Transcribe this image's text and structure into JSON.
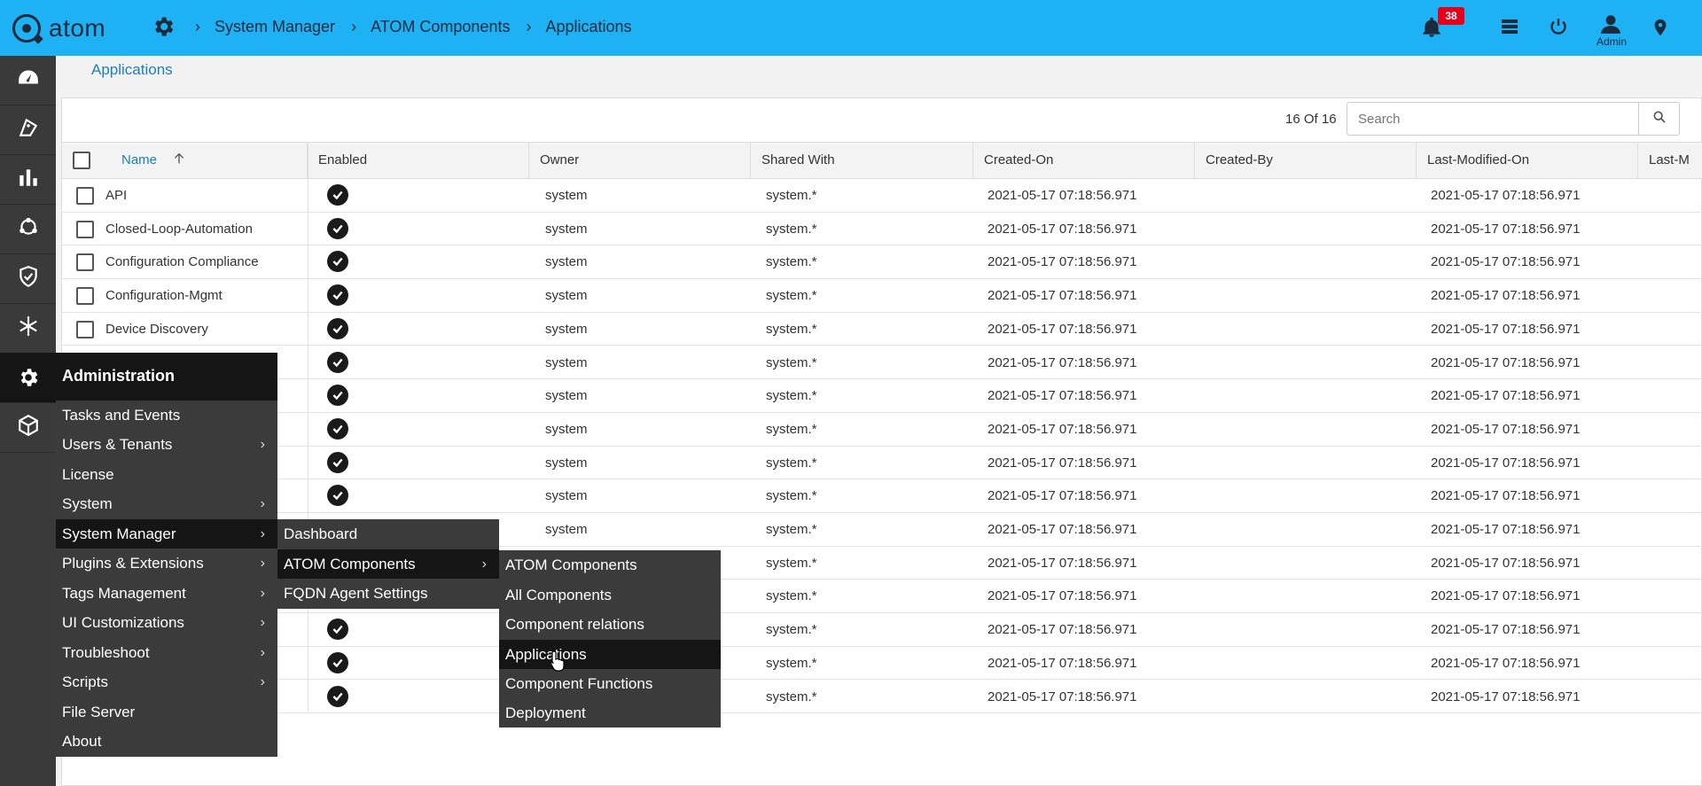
{
  "app": {
    "name": "atom"
  },
  "breadcrumb": [
    "System Manager",
    "ATOM Components",
    "Applications"
  ],
  "notifications": {
    "count": "38"
  },
  "user": {
    "label": "Admin"
  },
  "page": {
    "title": "Applications",
    "count": "16 Of 16"
  },
  "search": {
    "placeholder": "Search",
    "value": ""
  },
  "table": {
    "columns": [
      "Name",
      "Enabled",
      "Owner",
      "Shared With",
      "Created-On",
      "Created-By",
      "Last-Modified-On",
      "Last-M"
    ],
    "sort": {
      "column": "Name",
      "direction": "ascending"
    },
    "rows": [
      {
        "name": "API",
        "enabled": true,
        "owner": "system",
        "shared_with": "system.*",
        "created_on": "2021-05-17 07:18:56.971",
        "created_by": "",
        "last_modified_on": "2021-05-17 07:18:56.971"
      },
      {
        "name": "Closed-Loop-Automation",
        "enabled": true,
        "owner": "system",
        "shared_with": "system.*",
        "created_on": "2021-05-17 07:18:56.971",
        "created_by": "",
        "last_modified_on": "2021-05-17 07:18:56.971"
      },
      {
        "name": "Configuration Compliance",
        "enabled": true,
        "owner": "system",
        "shared_with": "system.*",
        "created_on": "2021-05-17 07:18:56.971",
        "created_by": "",
        "last_modified_on": "2021-05-17 07:18:56.971"
      },
      {
        "name": "Configuration-Mgmt",
        "enabled": true,
        "owner": "system",
        "shared_with": "system.*",
        "created_on": "2021-05-17 07:18:56.971",
        "created_by": "",
        "last_modified_on": "2021-05-17 07:18:56.971"
      },
      {
        "name": "Device Discovery",
        "enabled": true,
        "owner": "system",
        "shared_with": "system.*",
        "created_on": "2021-05-17 07:18:56.971",
        "created_by": "",
        "last_modified_on": "2021-05-17 07:18:56.971"
      },
      {
        "name": "",
        "enabled": true,
        "owner": "system",
        "shared_with": "system.*",
        "created_on": "2021-05-17 07:18:56.971",
        "created_by": "",
        "last_modified_on": "2021-05-17 07:18:56.971"
      },
      {
        "name": "",
        "enabled": true,
        "owner": "system",
        "shared_with": "system.*",
        "created_on": "2021-05-17 07:18:56.971",
        "created_by": "",
        "last_modified_on": "2021-05-17 07:18:56.971"
      },
      {
        "name": "",
        "enabled": true,
        "owner": "system",
        "shared_with": "system.*",
        "created_on": "2021-05-17 07:18:56.971",
        "created_by": "",
        "last_modified_on": "2021-05-17 07:18:56.971"
      },
      {
        "name": "",
        "enabled": true,
        "owner": "system",
        "shared_with": "system.*",
        "created_on": "2021-05-17 07:18:56.971",
        "created_by": "",
        "last_modified_on": "2021-05-17 07:18:56.971"
      },
      {
        "name": "",
        "enabled": true,
        "owner": "system",
        "shared_with": "system.*",
        "created_on": "2021-05-17 07:18:56.971",
        "created_by": "",
        "last_modified_on": "2021-05-17 07:18:56.971"
      },
      {
        "name": "",
        "enabled": true,
        "owner": "system",
        "shared_with": "system.*",
        "created_on": "2021-05-17 07:18:56.971",
        "created_by": "",
        "last_modified_on": "2021-05-17 07:18:56.971"
      },
      {
        "name": "",
        "enabled": true,
        "owner": "",
        "shared_with": "system.*",
        "created_on": "2021-05-17 07:18:56.971",
        "created_by": "",
        "last_modified_on": "2021-05-17 07:18:56.971"
      },
      {
        "name": "",
        "enabled": true,
        "owner": "",
        "shared_with": "system.*",
        "created_on": "2021-05-17 07:18:56.971",
        "created_by": "",
        "last_modified_on": "2021-05-17 07:18:56.971"
      },
      {
        "name": "",
        "enabled": true,
        "owner": "",
        "shared_with": "system.*",
        "created_on": "2021-05-17 07:18:56.971",
        "created_by": "",
        "last_modified_on": "2021-05-17 07:18:56.971"
      },
      {
        "name": "",
        "enabled": true,
        "owner": "",
        "shared_with": "system.*",
        "created_on": "2021-05-17 07:18:56.971",
        "created_by": "",
        "last_modified_on": "2021-05-17 07:18:56.971"
      },
      {
        "name": "",
        "enabled": true,
        "owner": "",
        "shared_with": "system.*",
        "created_on": "2021-05-17 07:18:56.971",
        "created_by": "",
        "last_modified_on": "2021-05-17 07:18:56.971"
      }
    ]
  },
  "menu_admin": {
    "title": "Administration",
    "items": [
      {
        "label": "Tasks and Events",
        "submenu": false
      },
      {
        "label": "Users & Tenants",
        "submenu": true
      },
      {
        "label": "License",
        "submenu": false
      },
      {
        "label": "System",
        "submenu": true
      },
      {
        "label": "System Manager",
        "submenu": true
      },
      {
        "label": "Plugins & Extensions",
        "submenu": true
      },
      {
        "label": "Tags Management",
        "submenu": true
      },
      {
        "label": "UI Customizations",
        "submenu": true
      },
      {
        "label": "Troubleshoot",
        "submenu": true
      },
      {
        "label": "Scripts",
        "submenu": true
      },
      {
        "label": "File Server",
        "submenu": false
      },
      {
        "label": "About",
        "submenu": false
      }
    ],
    "active": "System Manager"
  },
  "menu_system_manager": {
    "items": [
      {
        "label": "Dashboard",
        "submenu": false
      },
      {
        "label": "ATOM Components",
        "submenu": true
      },
      {
        "label": "FQDN Agent Settings",
        "submenu": false
      }
    ],
    "active": "ATOM Components"
  },
  "menu_atom_components": {
    "items": [
      {
        "label": "ATOM Components"
      },
      {
        "label": "All Components"
      },
      {
        "label": "Component relations"
      },
      {
        "label": "Applications"
      },
      {
        "label": "Component Functions"
      },
      {
        "label": "Deployment"
      }
    ],
    "active": "Applications"
  },
  "colors": {
    "topbar": "#1eb1f4",
    "rail": "#3a3a3a",
    "menu": "#3b3b3b",
    "menu_active": "#151515",
    "link": "#1d7fb8",
    "badge": "#e3001b"
  }
}
